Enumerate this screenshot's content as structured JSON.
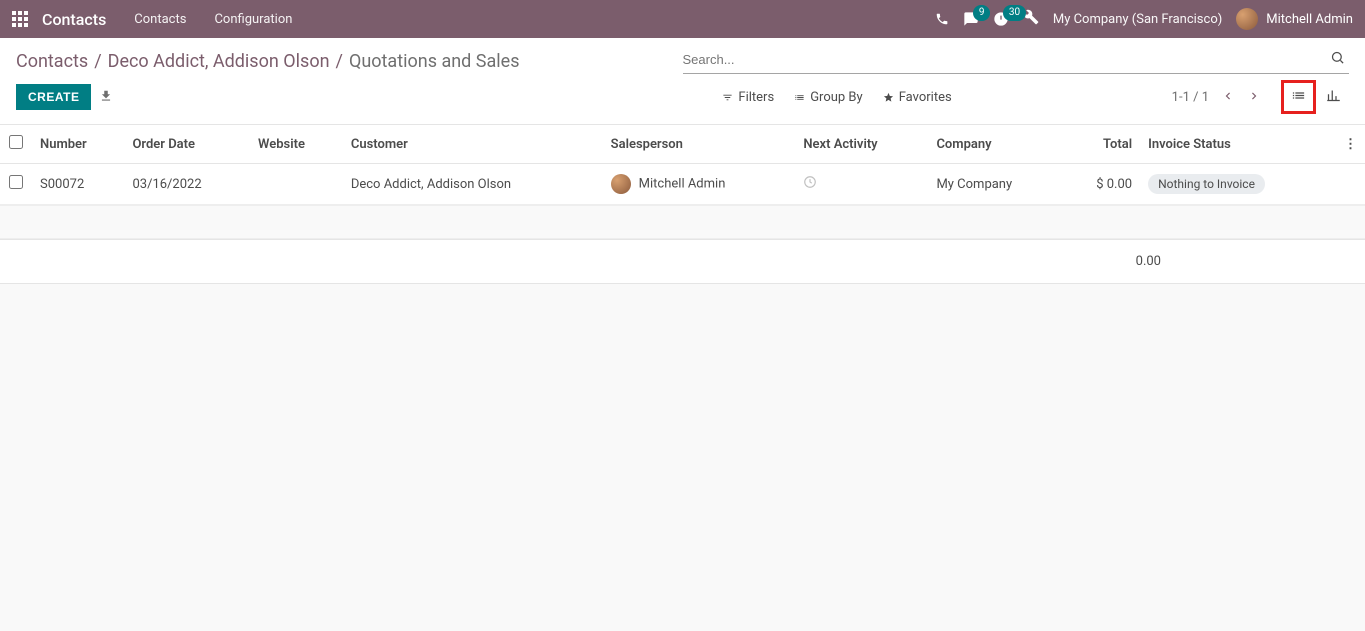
{
  "topbar": {
    "app_title": "Contacts",
    "nav": [
      "Contacts",
      "Configuration"
    ],
    "messages_badge": "9",
    "activities_badge": "30",
    "company": "My Company (San Francisco)",
    "user": "Mitchell Admin"
  },
  "breadcrumb": {
    "parts": [
      "Contacts",
      "Deco Addict, Addison Olson"
    ],
    "current": "Quotations and Sales"
  },
  "search": {
    "placeholder": "Search..."
  },
  "actions": {
    "create": "CREATE",
    "filters": "Filters",
    "groupby": "Group By",
    "favorites": "Favorites",
    "pager": "1-1 / 1"
  },
  "table": {
    "headers": {
      "number": "Number",
      "order_date": "Order Date",
      "website": "Website",
      "customer": "Customer",
      "salesperson": "Salesperson",
      "next_activity": "Next Activity",
      "company": "Company",
      "total": "Total",
      "invoice_status": "Invoice Status"
    },
    "rows": [
      {
        "number": "S00072",
        "order_date": "03/16/2022",
        "website": "",
        "customer": "Deco Addict, Addison Olson",
        "salesperson": "Mitchell Admin",
        "company": "My Company",
        "total": "$ 0.00",
        "invoice_status": "Nothing to Invoice"
      }
    ],
    "footer_total": "0.00"
  }
}
